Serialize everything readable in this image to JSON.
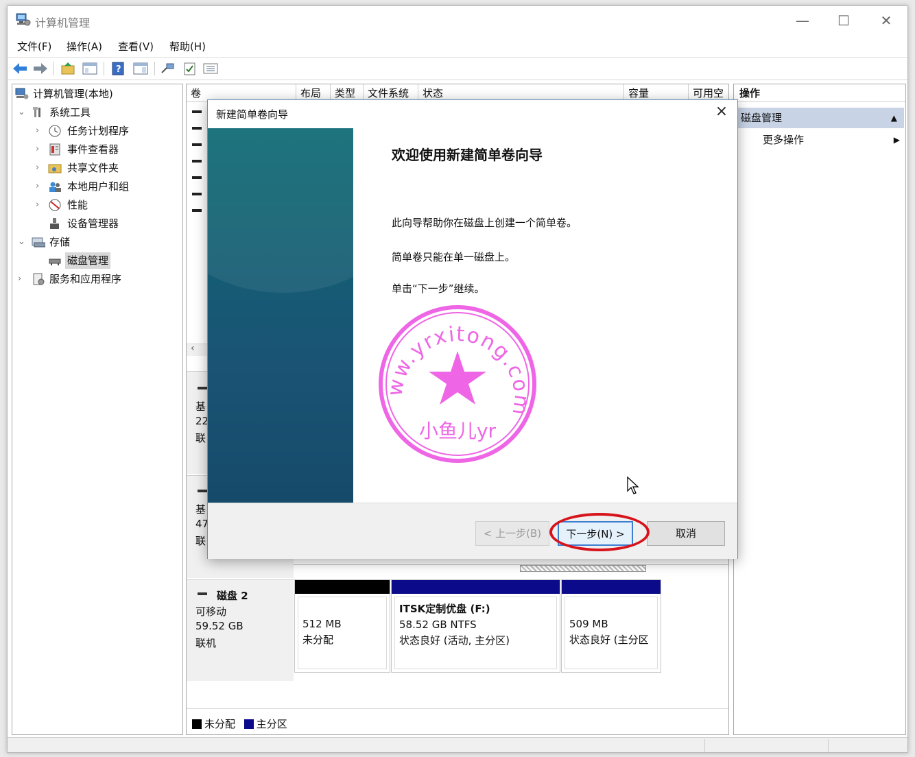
{
  "window": {
    "title": "计算机管理",
    "controls": {
      "minimize": "—",
      "maximize": "☐",
      "close": "✕"
    }
  },
  "menubar": [
    "文件(F)",
    "操作(A)",
    "查看(V)",
    "帮助(H)"
  ],
  "tree": {
    "root": "计算机管理(本地)",
    "system_tools": "系统工具",
    "task_scheduler": "任务计划程序",
    "event_viewer": "事件查看器",
    "shared_folders": "共享文件夹",
    "local_users": "本地用户和组",
    "performance": "性能",
    "device_manager": "设备管理器",
    "storage": "存储",
    "disk_management": "磁盘管理",
    "services_apps": "服务和应用程序"
  },
  "volume_list": {
    "columns": [
      "卷",
      "布局",
      "类型",
      "文件系统",
      "状态",
      "容量",
      "可用空"
    ]
  },
  "disks": {
    "disk0": {
      "name": "基",
      "size": "22",
      "status": "联"
    },
    "disk1": {
      "name": "基",
      "size": "47",
      "status": "联"
    },
    "disk2": {
      "name": "磁盘 2",
      "type": "可移动",
      "size": "59.52 GB",
      "status": "联机",
      "partitions": [
        {
          "line1": "512 MB",
          "line2": "未分配",
          "line3": "",
          "bar_color": "#000000"
        },
        {
          "line1": "ITSK定制优盘  (F:)",
          "line2": "58.52 GB NTFS",
          "line3": "状态良好 (活动, 主分区)",
          "bar_color": "#0a0a8a"
        },
        {
          "line1": "509 MB",
          "line2": "状态良好 (主分区",
          "line3": "",
          "bar_color": "#0a0a8a"
        }
      ]
    }
  },
  "legend": [
    {
      "label": "未分配",
      "color": "#000000"
    },
    {
      "label": "主分区",
      "color": "#0a0a8a"
    }
  ],
  "actions": {
    "header": "操作",
    "section": "磁盘管理",
    "more": "更多操作"
  },
  "wizard": {
    "title": "新建简单卷向导",
    "heading": "欢迎使用新建简单卷向导",
    "line1": "此向导帮助你在磁盘上创建一个简单卷。",
    "line2": "简单卷只能在单一磁盘上。",
    "line3": "单击“下一步”继续。",
    "back_button": "< 上一步(B)",
    "next_button": "下一步(N) >",
    "cancel_button": "取消"
  },
  "watermark": {
    "arc_text": "www.yrxitong.com",
    "bottom_text": "小鱼儿yr",
    "color": "#ee66e6"
  }
}
